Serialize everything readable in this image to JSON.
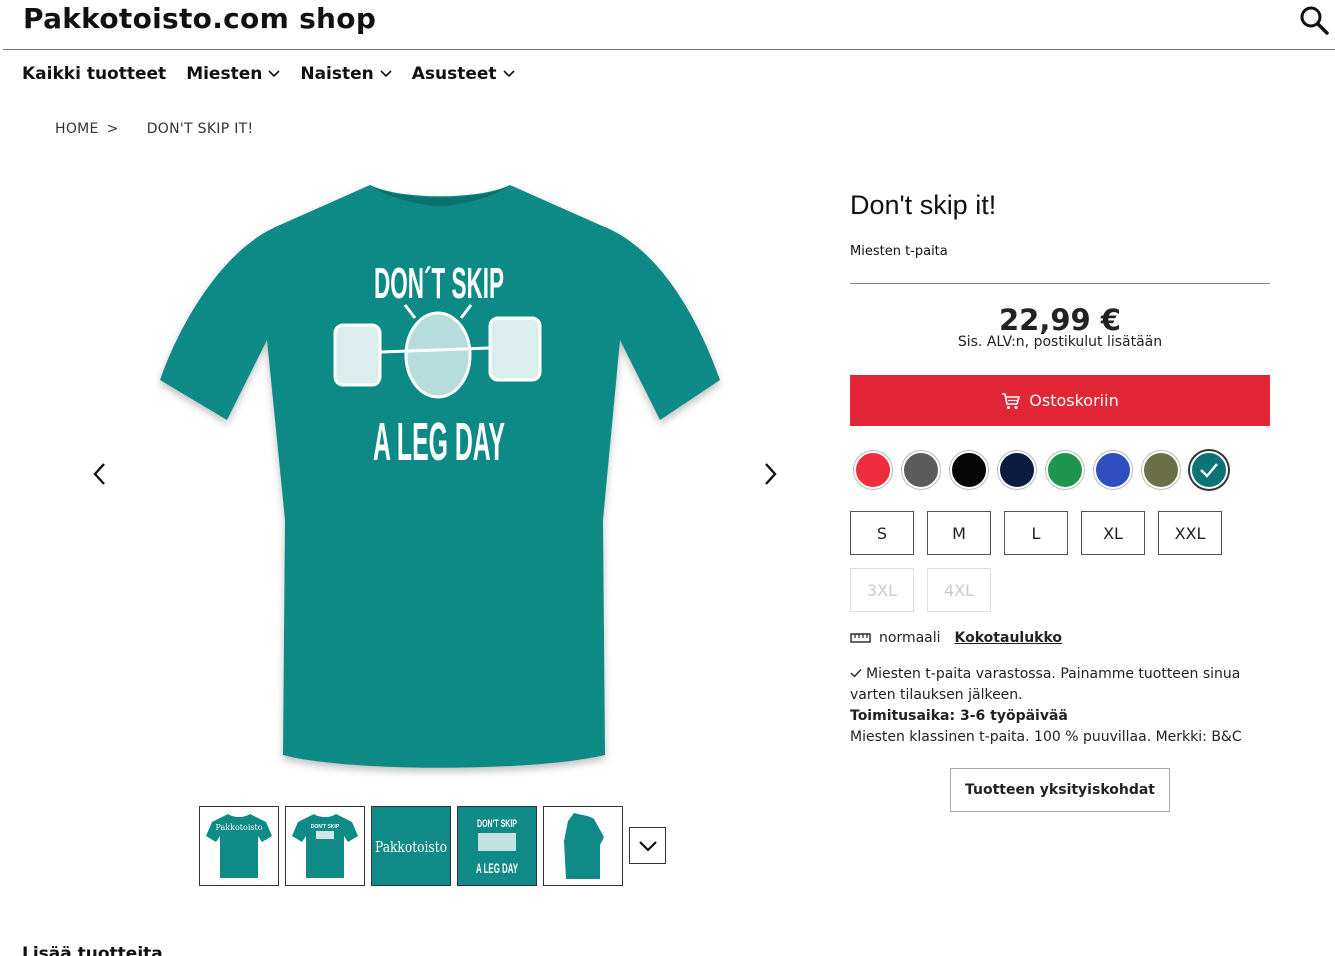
{
  "header": {
    "shop_title": "Pakkotoisto.com shop"
  },
  "nav": {
    "items": [
      {
        "label": "Kaikki tuotteet",
        "dropdown": false
      },
      {
        "label": "Miesten",
        "dropdown": true
      },
      {
        "label": "Naisten",
        "dropdown": true
      },
      {
        "label": "Asusteet",
        "dropdown": true
      }
    ]
  },
  "breadcrumb": {
    "home": "HOME",
    "separator": ">",
    "current": "DON'T SKIP IT!"
  },
  "product": {
    "title": "Don't skip it!",
    "subtitle": "Miesten t-paita",
    "price": "22,99 €",
    "price_note": "Sis. ALV:n, postikulut lisätään",
    "cart_label": "Ostoskoriin",
    "shirt_color": "#0f8a86",
    "print_text_top": "DON´T SKIP",
    "print_text_bottom": "A LEG DAY",
    "colors": [
      "#ee2e3c",
      "#5c5c5c",
      "#050505",
      "#0c1c40",
      "#1f9650",
      "#2e4fbd",
      "#6c7048",
      "#0c7376"
    ],
    "selected_color_index": 7,
    "sizes": [
      {
        "label": "S",
        "available": true
      },
      {
        "label": "M",
        "available": true
      },
      {
        "label": "L",
        "available": true
      },
      {
        "label": "XL",
        "available": true
      },
      {
        "label": "XXL",
        "available": true
      },
      {
        "label": "3XL",
        "available": false
      },
      {
        "label": "4XL",
        "available": false
      }
    ],
    "fit_label": "normaali",
    "size_table_label": "Kokotaulukko",
    "stock_text": "Miesten t-paita varastossa. Painamme tuotteen sinua varten tilauksen jälkeen.",
    "delivery_text": "Toimitusaika: 3-6 työpäivää",
    "description": "Miesten klassinen t-paita. 100 % puuvillaa. Merkki: B&C",
    "details_button": "Tuotteen yksityiskohdat"
  },
  "thumbnails": {
    "items": [
      {
        "name": "back-logo",
        "text": "Pakkotoisto"
      },
      {
        "name": "front-print",
        "text": "DON'T SKIP"
      },
      {
        "name": "logo-closeup",
        "text": "Pakkotoisto"
      },
      {
        "name": "print-closeup",
        "text_top": "DON'T SKIP",
        "text_bottom": "A LEG DAY"
      },
      {
        "name": "side-view",
        "text": ""
      }
    ]
  },
  "bottom": {
    "cut_text": "Lisää tuotteita"
  }
}
